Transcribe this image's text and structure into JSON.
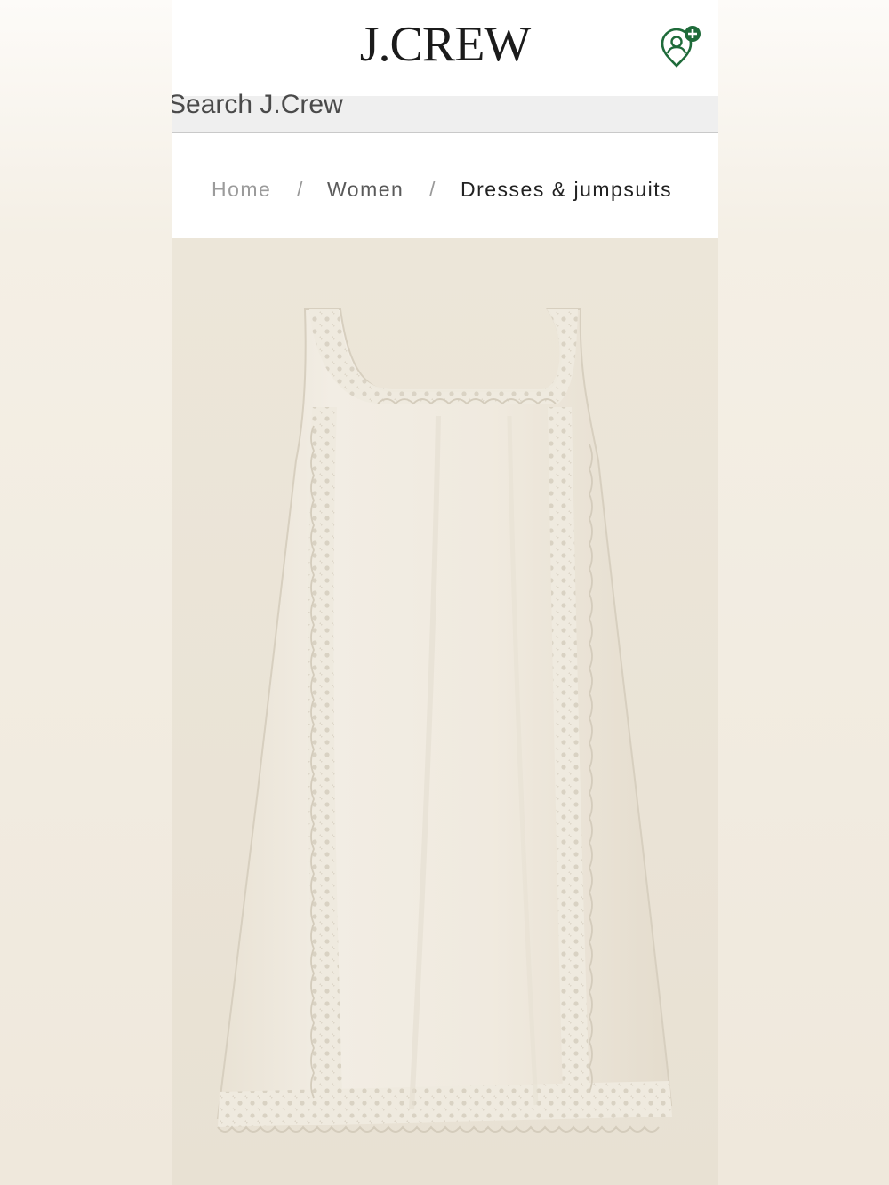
{
  "header": {
    "brand": "J.CREW",
    "profile_icon": "user-location-pin-plus-icon",
    "accent_color": "#1f6b3a"
  },
  "search": {
    "placeholder": "Search J.Crew"
  },
  "breadcrumb": {
    "items": [
      "Home",
      "Women",
      "Dresses & jumpsuits"
    ],
    "separator": "/"
  },
  "product": {
    "image": "cream-linen-lace-trim-mini-dress",
    "background_color": "#ebe5d8"
  }
}
